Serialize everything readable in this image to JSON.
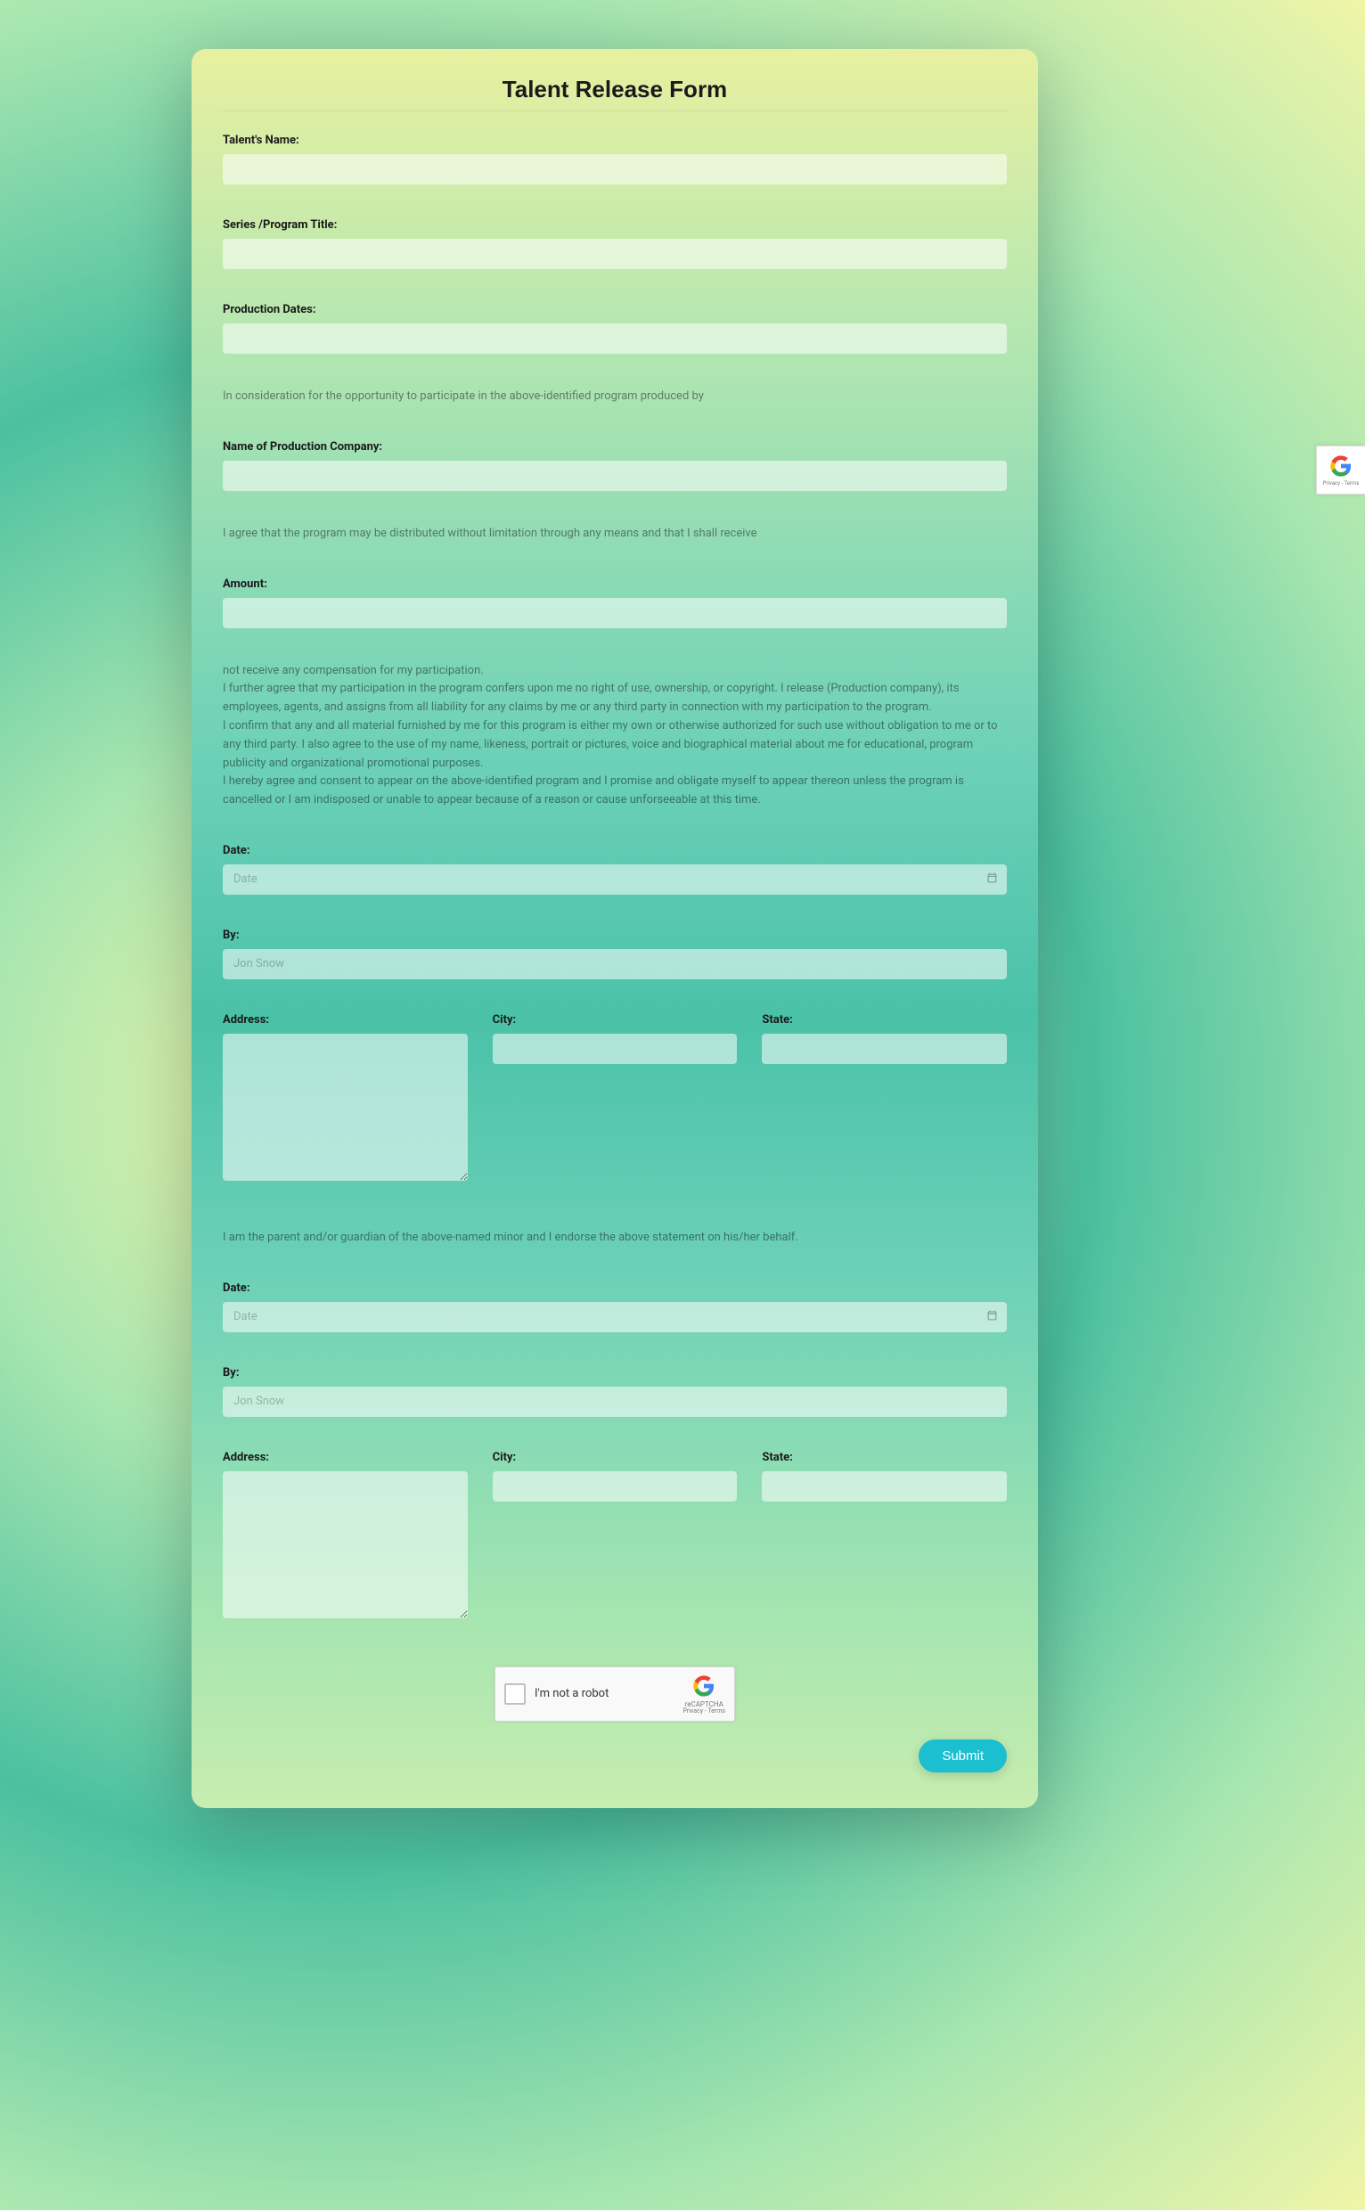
{
  "form": {
    "title": "Talent Release Form",
    "fields": {
      "talent_name": {
        "label": "Talent's Name:"
      },
      "series_title": {
        "label": "Series /Program Title:"
      },
      "production_dates": {
        "label": "Production Dates:"
      },
      "production_company": {
        "label": "Name of Production Company:"
      },
      "amount": {
        "label": "Amount:"
      },
      "date1": {
        "label": "Date:",
        "placeholder": "Date"
      },
      "by1": {
        "label": "By:",
        "placeholder": "Jon Snow"
      },
      "address1": {
        "label": "Address:"
      },
      "city1": {
        "label": "City:"
      },
      "state1": {
        "label": "State:"
      },
      "date2": {
        "label": "Date:",
        "placeholder": "Date"
      },
      "by2": {
        "label": "By:",
        "placeholder": "Jon Snow"
      },
      "address2": {
        "label": "Address:"
      },
      "city2": {
        "label": "City:"
      },
      "state2": {
        "label": "State:"
      }
    },
    "static_text": {
      "consideration": "In consideration for the opportunity to participate in the above-identified program produced by",
      "agree_distribute": "I agree that the program may be distributed without limitation through any means and that I shall receive",
      "terms_block": "not receive any compensation for my participation.\nI further agree that my participation in the program confers upon me no right of use, ownership, or copyright. I release (Production company), its employees, agents, and assigns from all liability for any claims by me or any third party in connection with my participation to the program.\nI confirm that any and all material furnished by me for this program is either my own or otherwise authorized for such use without obligation to me or to any third party. I also agree to the use of my name, likeness, portrait or pictures, voice and biographical material about me for educational, program publicity and organizational promotional purposes.\nI hereby agree and consent to appear on the above-identified program and I promise and obligate myself to appear thereon unless the program is cancelled or I am indisposed or unable to appear because of a reason or cause unforseeable at this time.",
      "guardian_statement": "I am the parent and/or guardian of the above-named minor and I endorse the above statement on his/her behalf."
    },
    "recaptcha": {
      "label": "I'm not a robot",
      "brand": "reCAPTCHA",
      "privacy": "Privacy - Terms"
    },
    "submit_label": "Submit"
  }
}
